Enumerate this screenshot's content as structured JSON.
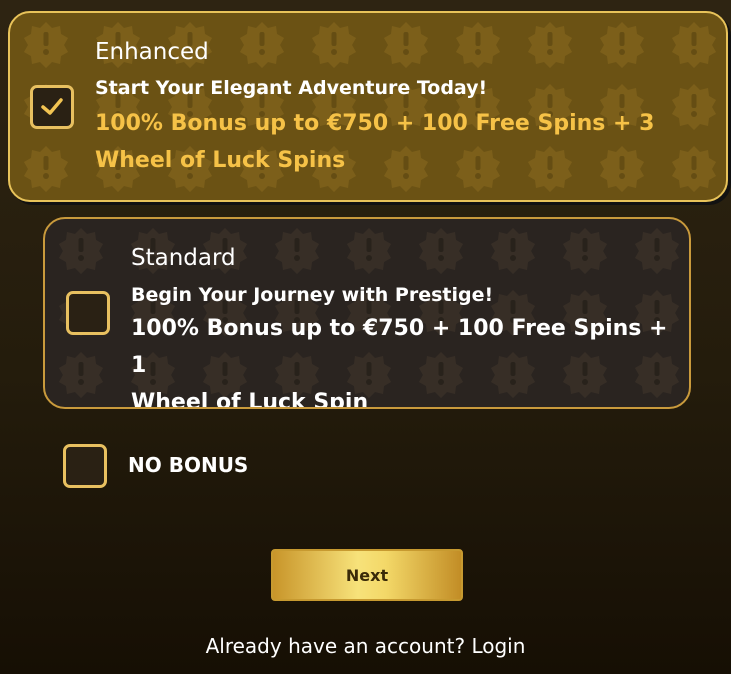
{
  "options": [
    {
      "title": "Enhanced",
      "subtitle": "Start Your Elegant Adventure Today!",
      "offer_line1": "100% Bonus up to €750 + 100 Free Spins + 3",
      "offer_line2": "Wheel of Luck Spins",
      "checked": true
    },
    {
      "title": "Standard",
      "subtitle": "Begin Your Journey with Prestige!",
      "offer_line1": "100% Bonus up to €750 + 100 Free Spins + 1",
      "offer_line2": "Wheel of Luck Spin",
      "checked": false
    }
  ],
  "no_bonus": {
    "label": "NO BONUS",
    "checked": false
  },
  "next_label": "Next",
  "login": {
    "prompt": "Already have an account?",
    "link": "Login"
  },
  "icons": {
    "checkmark": "check-icon",
    "pattern": "exclamation-badge-icon"
  },
  "colors": {
    "accent": "#f6c247",
    "border": "#e8c060",
    "selected_card": "#6b5214",
    "card": "#2a2420"
  }
}
